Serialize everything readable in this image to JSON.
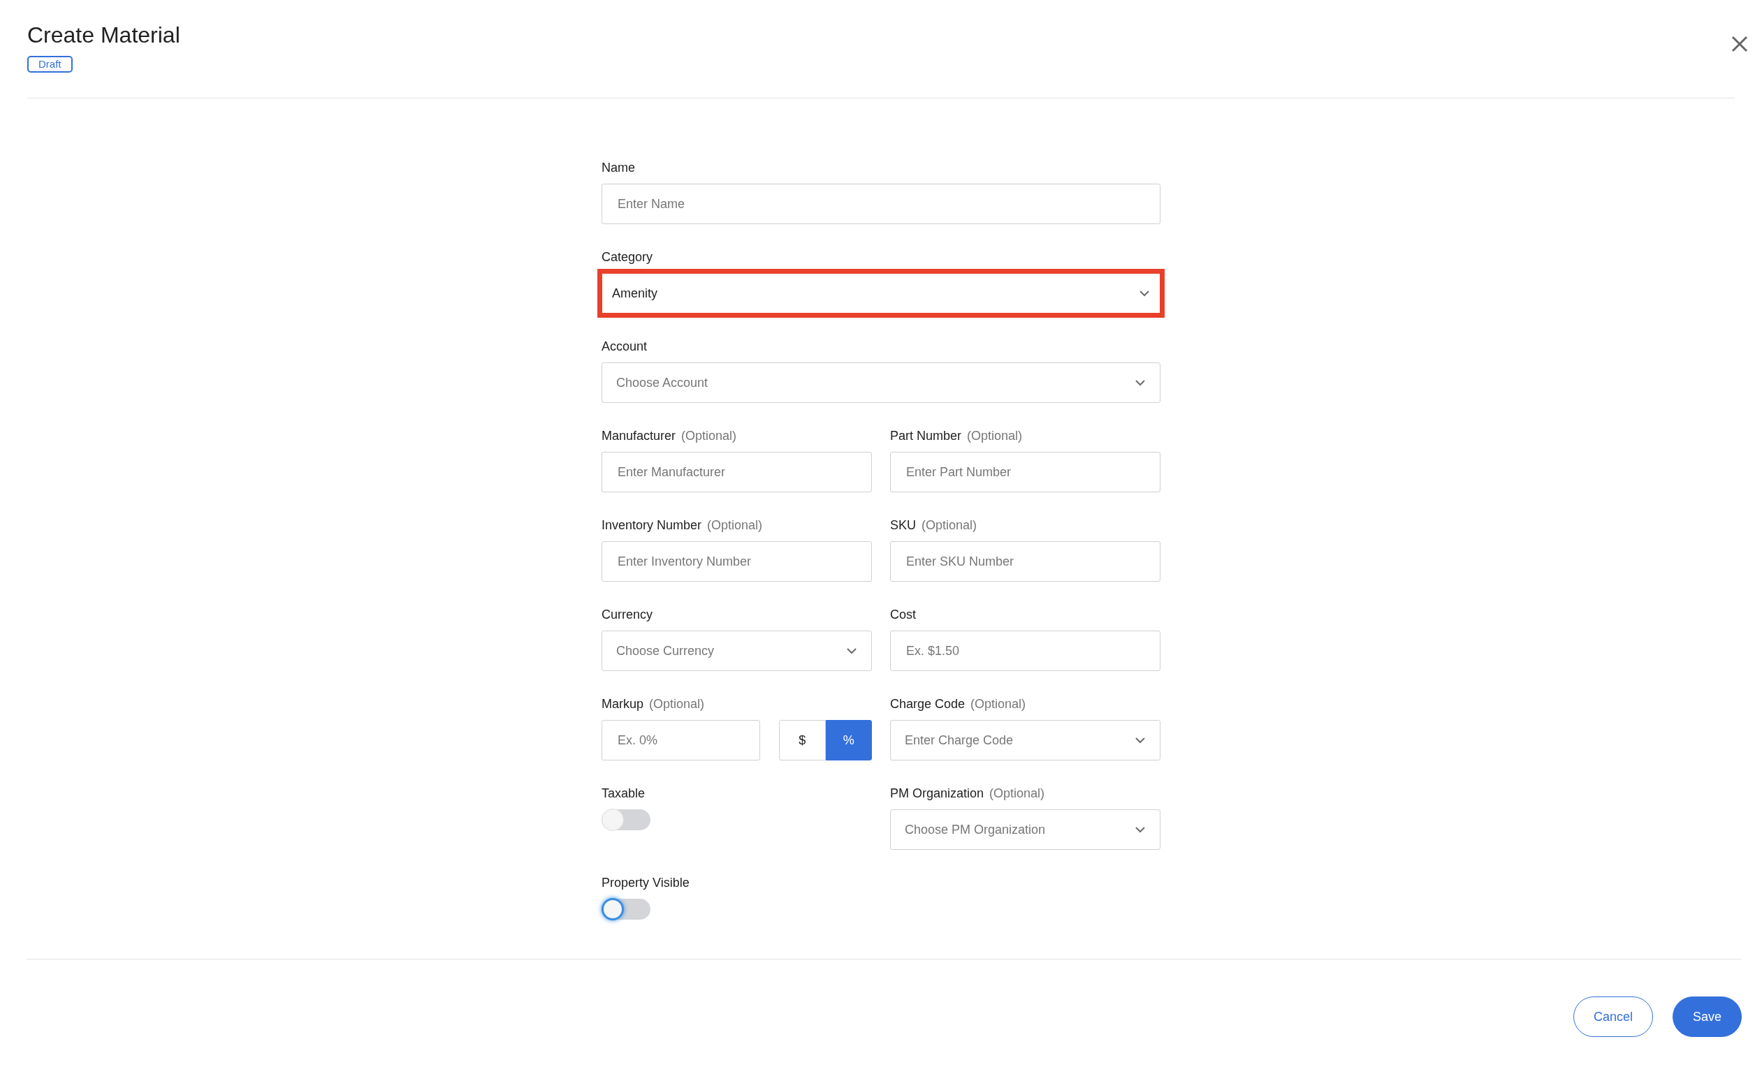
{
  "header": {
    "title": "Create Material",
    "status_badge": "Draft"
  },
  "rows": [
    [
      {
        "kind": "text",
        "label": "Name",
        "placeholder": "Enter Name"
      }
    ],
    [
      {
        "kind": "select",
        "label": "Category",
        "value": "Amenity",
        "highlighted": true
      }
    ],
    [
      {
        "kind": "select",
        "label": "Account",
        "placeholder": "Choose Account",
        "highlighted": false
      }
    ],
    [
      {
        "kind": "text",
        "label": "Manufacturer",
        "optional": "(Optional)",
        "placeholder": "Enter Manufacturer"
      },
      {
        "kind": "text",
        "label": "Part Number",
        "optional": "(Optional)",
        "placeholder": "Enter Part Number"
      }
    ],
    [
      {
        "kind": "text",
        "label": "Inventory Number",
        "optional": "(Optional)",
        "placeholder": "Enter Inventory Number"
      },
      {
        "kind": "text",
        "label": "SKU",
        "optional": "(Optional)",
        "placeholder": "Enter SKU Number"
      }
    ],
    [
      {
        "kind": "select",
        "label": "Currency",
        "placeholder": "Choose Currency",
        "highlighted": false
      },
      {
        "kind": "text",
        "label": "Cost",
        "placeholder": "Ex. $1.50"
      }
    ],
    [
      {
        "kind": "markup",
        "label": "Markup",
        "optional": "(Optional)",
        "placeholder": "Ex. 0%",
        "units": [
          {
            "label": "$",
            "selected": false
          },
          {
            "label": "%",
            "selected": true
          }
        ]
      },
      {
        "kind": "select",
        "label": "Charge Code",
        "optional": "(Optional)",
        "placeholder": "Enter Charge Code",
        "highlighted": false
      }
    ],
    [
      {
        "kind": "toggle",
        "label": "Taxable",
        "on": false,
        "focused": false
      },
      {
        "kind": "select",
        "label": "PM Organization",
        "optional": "(Optional)",
        "placeholder": "Choose PM Organization",
        "highlighted": false
      }
    ],
    [
      {
        "kind": "toggle",
        "label": "Property Visible",
        "on": false,
        "focused": true
      }
    ]
  ],
  "footer": {
    "buttons": [
      {
        "kind": "secondary",
        "label": "Cancel"
      },
      {
        "kind": "primary",
        "label": "Save"
      }
    ]
  }
}
